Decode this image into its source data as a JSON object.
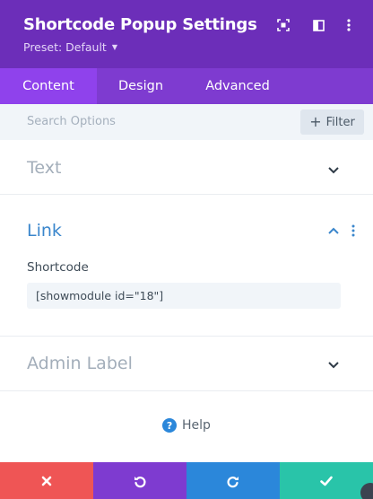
{
  "header": {
    "title": "Shortcode Popup Settings",
    "preset_label": "Preset: Default",
    "colors": {
      "background": "#6c2eb9",
      "tabs": "#7e3bd0",
      "active_tab": "#8f42ec"
    }
  },
  "tabs": [
    {
      "label": "Content",
      "active": true
    },
    {
      "label": "Design",
      "active": false
    },
    {
      "label": "Advanced",
      "active": false
    }
  ],
  "search": {
    "placeholder": "Search Options",
    "filter_label": "Filter"
  },
  "sections": {
    "text": {
      "title": "Text",
      "state": "collapsed"
    },
    "link": {
      "title": "Link",
      "state": "expanded",
      "field_label": "Shortcode",
      "field_value": "[showmodule id=\"18\"]"
    },
    "admin_label": {
      "title": "Admin Label",
      "state": "collapsed"
    }
  },
  "help": {
    "label": "Help",
    "icon": "?"
  },
  "footer": {
    "buttons": [
      {
        "name": "cancel",
        "icon": "close-icon",
        "color": "#ef5555"
      },
      {
        "name": "undo",
        "icon": "undo-icon",
        "color": "#7e3bd0"
      },
      {
        "name": "redo",
        "icon": "redo-icon",
        "color": "#2b87da"
      },
      {
        "name": "save",
        "icon": "check-icon",
        "color": "#29c4a9"
      }
    ]
  }
}
